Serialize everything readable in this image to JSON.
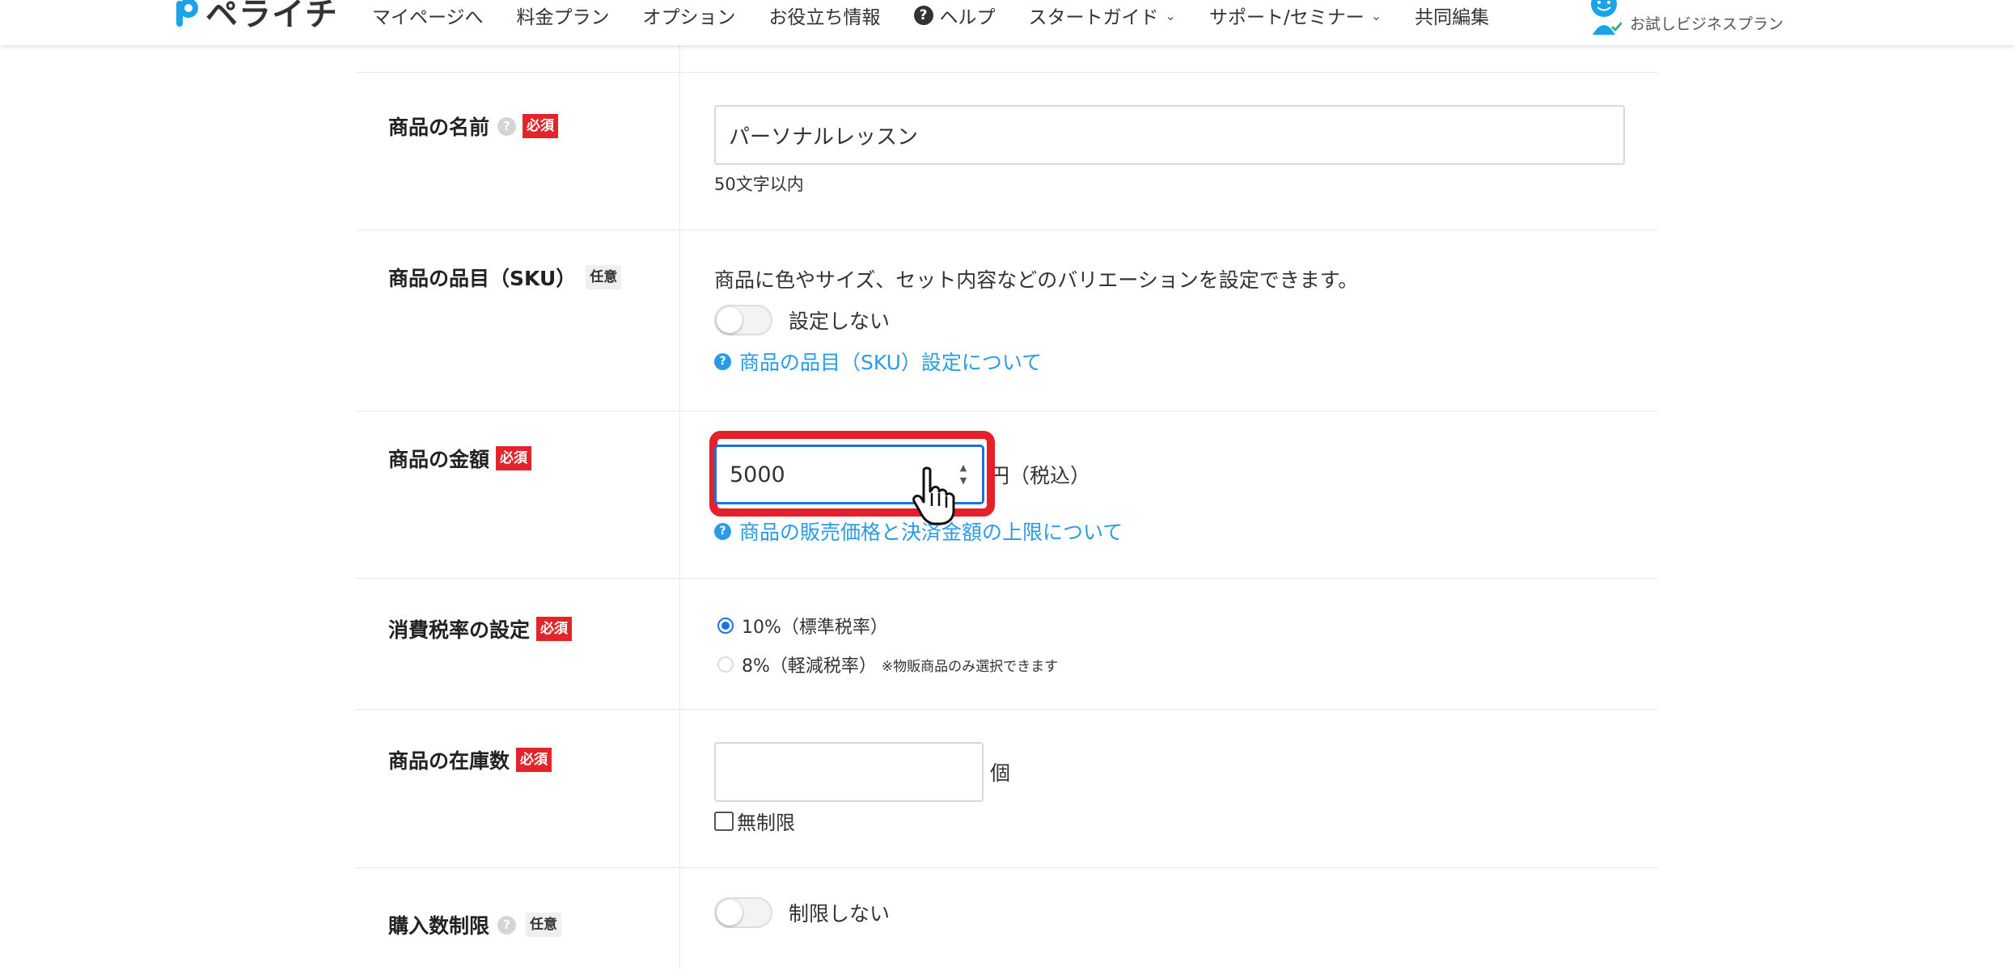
{
  "header": {
    "logo_text": "ペライチ",
    "nav": [
      {
        "label": "マイページへ"
      },
      {
        "label": "料金プラン"
      },
      {
        "label": "オプション"
      },
      {
        "label": "お役立ち情報"
      },
      {
        "label": "ヘルプ"
      },
      {
        "label": "スタートガイド"
      },
      {
        "label": "サポート/セミナー"
      },
      {
        "label": "共同編集"
      }
    ],
    "plan_label": "お試しビジネスプラン"
  },
  "badges": {
    "required": "必須",
    "optional": "任意"
  },
  "rows": {
    "name": {
      "label": "商品の名前",
      "value": "パーソナルレッスン",
      "hint": "50文字以内"
    },
    "sku": {
      "label": "商品の品目（SKU）",
      "description": "商品に色やサイズ、セット内容などのバリエーションを設定できます。",
      "toggle_label": "設定しない",
      "link": "商品の品目（SKU）設定について"
    },
    "price": {
      "label": "商品の金額",
      "value": "5000",
      "unit": "円（税込）",
      "link": "商品の販売価格と決済金額の上限について"
    },
    "tax": {
      "label": "消費税率の設定",
      "options": [
        {
          "label": "10%（標準税率）",
          "checked": true,
          "note": ""
        },
        {
          "label": "8%（軽減税率）",
          "checked": false,
          "note": "※物販商品のみ選択できます"
        }
      ]
    },
    "stock": {
      "label": "商品の在庫数",
      "value": "",
      "unit": "個",
      "unlimited_label": "無制限"
    },
    "limit": {
      "label": "購入数制限",
      "toggle_label": "制限しない"
    }
  },
  "colors": {
    "required_badge": "#e3242b",
    "link": "#2a9be6",
    "highlight": "#e6202a",
    "focus": "#1e6fd9"
  }
}
